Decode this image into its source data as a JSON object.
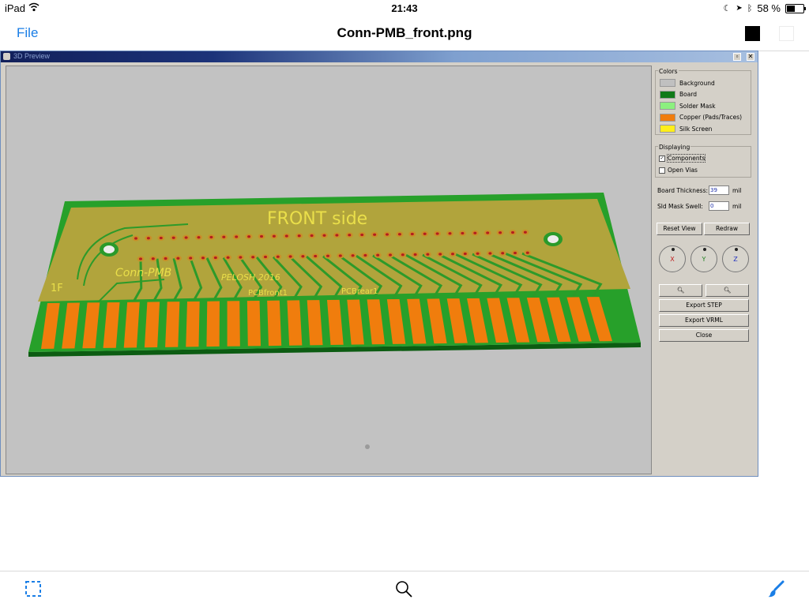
{
  "status_bar": {
    "carrier": "iPad",
    "time": "21:43",
    "battery": "58 %",
    "battery_level": 0.58
  },
  "nav": {
    "file_label": "File",
    "title": "Conn-PMB_front.png"
  },
  "window": {
    "title": "3D Preview"
  },
  "board": {
    "title_text": "FRONT  side",
    "label_conn": "Conn-PMB",
    "label_pelosh": "PELOSH 2016",
    "label_front": "PCBfront1",
    "label_rear": "PCBrear1",
    "label_1f": "1F"
  },
  "panel": {
    "colors_label": "Colors",
    "colors": [
      {
        "name": "Background",
        "color": "#c0c0c0"
      },
      {
        "name": "Board",
        "color": "#0f7a18"
      },
      {
        "name": "Solder Mask",
        "color": "#8cf07f"
      },
      {
        "name": "Copper (Pads/Traces)",
        "color": "#f07d0d"
      },
      {
        "name": "Silk Screen",
        "color": "#ffee1a"
      }
    ],
    "displaying_label": "Displaying",
    "components_label": "Components",
    "components_checked": true,
    "open_vias_label": "Open Vias",
    "open_vias_checked": false,
    "board_thickness_label": "Board Thickness:",
    "board_thickness_value": "39",
    "board_thickness_unit": "mil",
    "sld_mask_label": "Sld Mask Swell:",
    "sld_mask_value": "0",
    "sld_mask_unit": "mil",
    "reset_view": "Reset View",
    "redraw": "Redraw",
    "axes": [
      "X",
      "Y",
      "Z"
    ],
    "zoom_in": "+",
    "zoom_out": "−",
    "export_step": "Export STEP",
    "export_vrml": "Export VRML",
    "close": "Close"
  }
}
